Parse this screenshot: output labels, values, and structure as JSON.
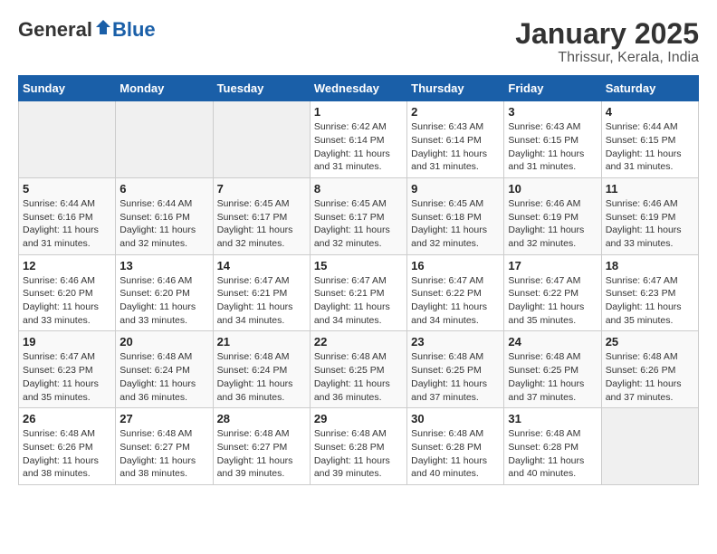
{
  "header": {
    "logo_general": "General",
    "logo_blue": "Blue",
    "title": "January 2025",
    "subtitle": "Thrissur, Kerala, India"
  },
  "days_of_week": [
    "Sunday",
    "Monday",
    "Tuesday",
    "Wednesday",
    "Thursday",
    "Friday",
    "Saturday"
  ],
  "weeks": [
    [
      {
        "day": "",
        "info": ""
      },
      {
        "day": "",
        "info": ""
      },
      {
        "day": "",
        "info": ""
      },
      {
        "day": "1",
        "info": "Sunrise: 6:42 AM\nSunset: 6:14 PM\nDaylight: 11 hours and 31 minutes."
      },
      {
        "day": "2",
        "info": "Sunrise: 6:43 AM\nSunset: 6:14 PM\nDaylight: 11 hours and 31 minutes."
      },
      {
        "day": "3",
        "info": "Sunrise: 6:43 AM\nSunset: 6:15 PM\nDaylight: 11 hours and 31 minutes."
      },
      {
        "day": "4",
        "info": "Sunrise: 6:44 AM\nSunset: 6:15 PM\nDaylight: 11 hours and 31 minutes."
      }
    ],
    [
      {
        "day": "5",
        "info": "Sunrise: 6:44 AM\nSunset: 6:16 PM\nDaylight: 11 hours and 31 minutes."
      },
      {
        "day": "6",
        "info": "Sunrise: 6:44 AM\nSunset: 6:16 PM\nDaylight: 11 hours and 32 minutes."
      },
      {
        "day": "7",
        "info": "Sunrise: 6:45 AM\nSunset: 6:17 PM\nDaylight: 11 hours and 32 minutes."
      },
      {
        "day": "8",
        "info": "Sunrise: 6:45 AM\nSunset: 6:17 PM\nDaylight: 11 hours and 32 minutes."
      },
      {
        "day": "9",
        "info": "Sunrise: 6:45 AM\nSunset: 6:18 PM\nDaylight: 11 hours and 32 minutes."
      },
      {
        "day": "10",
        "info": "Sunrise: 6:46 AM\nSunset: 6:19 PM\nDaylight: 11 hours and 32 minutes."
      },
      {
        "day": "11",
        "info": "Sunrise: 6:46 AM\nSunset: 6:19 PM\nDaylight: 11 hours and 33 minutes."
      }
    ],
    [
      {
        "day": "12",
        "info": "Sunrise: 6:46 AM\nSunset: 6:20 PM\nDaylight: 11 hours and 33 minutes."
      },
      {
        "day": "13",
        "info": "Sunrise: 6:46 AM\nSunset: 6:20 PM\nDaylight: 11 hours and 33 minutes."
      },
      {
        "day": "14",
        "info": "Sunrise: 6:47 AM\nSunset: 6:21 PM\nDaylight: 11 hours and 34 minutes."
      },
      {
        "day": "15",
        "info": "Sunrise: 6:47 AM\nSunset: 6:21 PM\nDaylight: 11 hours and 34 minutes."
      },
      {
        "day": "16",
        "info": "Sunrise: 6:47 AM\nSunset: 6:22 PM\nDaylight: 11 hours and 34 minutes."
      },
      {
        "day": "17",
        "info": "Sunrise: 6:47 AM\nSunset: 6:22 PM\nDaylight: 11 hours and 35 minutes."
      },
      {
        "day": "18",
        "info": "Sunrise: 6:47 AM\nSunset: 6:23 PM\nDaylight: 11 hours and 35 minutes."
      }
    ],
    [
      {
        "day": "19",
        "info": "Sunrise: 6:47 AM\nSunset: 6:23 PM\nDaylight: 11 hours and 35 minutes."
      },
      {
        "day": "20",
        "info": "Sunrise: 6:48 AM\nSunset: 6:24 PM\nDaylight: 11 hours and 36 minutes."
      },
      {
        "day": "21",
        "info": "Sunrise: 6:48 AM\nSunset: 6:24 PM\nDaylight: 11 hours and 36 minutes."
      },
      {
        "day": "22",
        "info": "Sunrise: 6:48 AM\nSunset: 6:25 PM\nDaylight: 11 hours and 36 minutes."
      },
      {
        "day": "23",
        "info": "Sunrise: 6:48 AM\nSunset: 6:25 PM\nDaylight: 11 hours and 37 minutes."
      },
      {
        "day": "24",
        "info": "Sunrise: 6:48 AM\nSunset: 6:25 PM\nDaylight: 11 hours and 37 minutes."
      },
      {
        "day": "25",
        "info": "Sunrise: 6:48 AM\nSunset: 6:26 PM\nDaylight: 11 hours and 37 minutes."
      }
    ],
    [
      {
        "day": "26",
        "info": "Sunrise: 6:48 AM\nSunset: 6:26 PM\nDaylight: 11 hours and 38 minutes."
      },
      {
        "day": "27",
        "info": "Sunrise: 6:48 AM\nSunset: 6:27 PM\nDaylight: 11 hours and 38 minutes."
      },
      {
        "day": "28",
        "info": "Sunrise: 6:48 AM\nSunset: 6:27 PM\nDaylight: 11 hours and 39 minutes."
      },
      {
        "day": "29",
        "info": "Sunrise: 6:48 AM\nSunset: 6:28 PM\nDaylight: 11 hours and 39 minutes."
      },
      {
        "day": "30",
        "info": "Sunrise: 6:48 AM\nSunset: 6:28 PM\nDaylight: 11 hours and 40 minutes."
      },
      {
        "day": "31",
        "info": "Sunrise: 6:48 AM\nSunset: 6:28 PM\nDaylight: 11 hours and 40 minutes."
      },
      {
        "day": "",
        "info": ""
      }
    ]
  ]
}
